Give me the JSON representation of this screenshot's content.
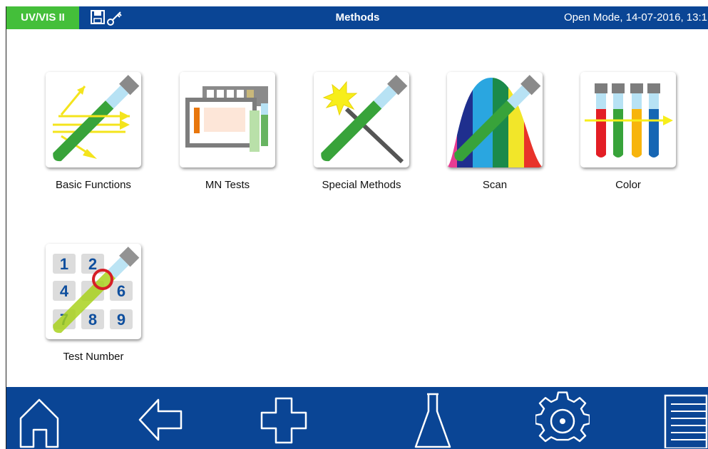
{
  "header": {
    "mode_label": "UV/VIS II",
    "title": "Methods",
    "status": "Open Mode, 14-07-2016, 13:1",
    "icons": [
      "save-icon",
      "key-icon"
    ]
  },
  "tiles": [
    {
      "label": "Basic Functions",
      "icon": "basic-functions-icon"
    },
    {
      "label": "MN Tests",
      "icon": "mn-tests-icon"
    },
    {
      "label": "Special Methods",
      "icon": "special-methods-icon"
    },
    {
      "label": "Scan",
      "icon": "scan-icon"
    },
    {
      "label": "Color",
      "icon": "color-icon"
    },
    {
      "label": "Test Number",
      "icon": "test-number-icon"
    }
  ],
  "test_number_keys": [
    "1",
    "2",
    "4",
    "6",
    "7",
    "8",
    "9"
  ],
  "bottom_nav": [
    "home-icon",
    "back-arrow-icon",
    "plus-icon",
    "flask-icon",
    "gear-icon",
    "menu-icon"
  ],
  "colors": {
    "header_blue": "#0a4595",
    "mode_green": "#44bf3a",
    "tube_green": "#38a33a",
    "tube_cap": "#8a8a8a",
    "key_blue": "#0f4f9e"
  }
}
